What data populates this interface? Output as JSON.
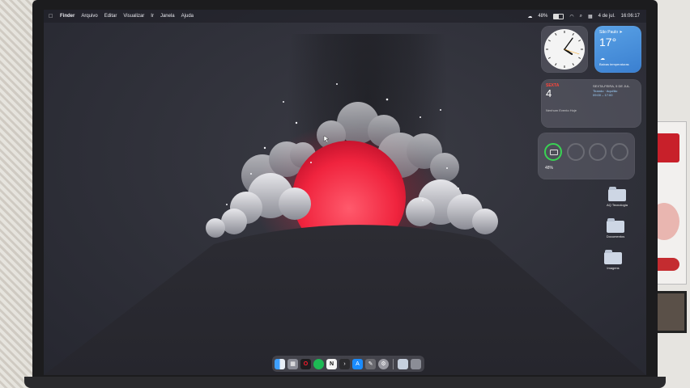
{
  "menubar": {
    "apple_icon": "apple-icon",
    "items": [
      "Finder",
      "Arquivo",
      "Editar",
      "Visualizar",
      "Ir",
      "Janela",
      "Ajuda"
    ],
    "battery_percent": "48%",
    "battery_level": 0.48,
    "date": "4 de jul.",
    "time": "16:06:17"
  },
  "widgets": {
    "clock": {
      "hour": 4,
      "minute": 6
    },
    "weather": {
      "city": "São Paulo ➤",
      "temperature": "17°",
      "condition": "Baixas temperaturas"
    },
    "calendar": {
      "weekday": "SEXTA",
      "day": "4",
      "upcoming_header": "SEXTA-FEIRA, 5 DE JUL.",
      "event_title": "Tirando · Aqui/ão",
      "event_time": "09:00 – 17:00",
      "no_events": "Nenhum Evento Hoje"
    },
    "batteries": {
      "percent": "48%",
      "level": 0.48
    }
  },
  "desktop_icons": [
    {
      "label": "AQ Tecnologia",
      "icon": "folder-icon"
    },
    {
      "label": "Documentos",
      "icon": "folder-icon"
    },
    {
      "label": "Imagens",
      "icon": "folder-icon"
    }
  ],
  "dock": {
    "apps": [
      "finder-icon",
      "launchpad-icon",
      "opera-icon",
      "spotify-icon",
      "notion-icon",
      "terminal-icon",
      "app-store-icon",
      "scripts-icon",
      "settings-icon"
    ],
    "trailing": [
      "folder-icon",
      "trash-icon"
    ]
  },
  "colors": {
    "sun": "#ff2a4a",
    "wallpaper": "#30313a",
    "battery_ring": "#39d353",
    "weather_bg": "#4a90dc"
  }
}
